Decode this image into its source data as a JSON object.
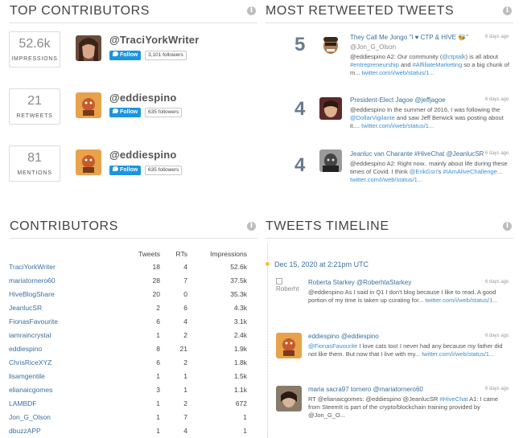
{
  "top_contributors": {
    "title": "TOP CONTRIBUTORS",
    "rows": [
      {
        "stat_value": "52.6k",
        "stat_label": "IMPRESSIONS",
        "handle": "@TraciYorkWriter",
        "follow_label": "Follow",
        "followers": "3,101 followers"
      },
      {
        "stat_value": "21",
        "stat_label": "RETWEETS",
        "handle": "@eddiespino",
        "follow_label": "Follow",
        "followers": "635 followers"
      },
      {
        "stat_value": "81",
        "stat_label": "MENTIONS",
        "handle": "@eddiespino",
        "follow_label": "Follow",
        "followers": "635 followers"
      }
    ]
  },
  "most_retweeted": {
    "title": "MOST RETWEETED TWEETS",
    "tweets": [
      {
        "count": "5",
        "name": "They Call Me Jongo \"I ♥ CTP & HIVE 🐝\"",
        "handle": "@Jon_G_Olson",
        "time": "6 days ago",
        "text_plain_1": "@eddiespino A2: Our community (",
        "text_link_1": "@ctptalk",
        "text_plain_2": ") is all about ",
        "text_link_2": "#entrepreneurship",
        "text_plain_3": " and ",
        "text_link_3": "#AffiliateMarketing",
        "text_plain_4": " so a big chunk of m... ",
        "url": "twitter.com/i/web/status/1..."
      },
      {
        "count": "4",
        "name": "President-Elect Jagoe",
        "handle": "@jeffjagoe",
        "time": "6 days ago",
        "text_plain_1": "@eddiespino In the summer of 2016, I was following the ",
        "text_link_1": "@DollarVigilante",
        "text_plain_2": " and saw Jeff Berwick was posting about it.... ",
        "url": "twitter.com/i/web/status/1..."
      },
      {
        "count": "4",
        "name": "Jeanluc van Charante #HiveChat",
        "handle": "@JeanlucSR",
        "time": "6 days ago",
        "text_plain_1": "@eddiespino A2: Right now.. mainly about life during these times of Covid. I think ",
        "text_link_1": "@ErikGsn",
        "text_plain_2": "'s ",
        "text_link_2": "#IAmAliveChallenge",
        "text_plain_3": "... ",
        "url": "twitter.com/i/web/status/1..."
      }
    ]
  },
  "contributors": {
    "title": "CONTRIBUTORS",
    "columns": [
      "Tweets",
      "RTs",
      "Impressions"
    ],
    "rows": [
      {
        "user": "TraciYorkWriter",
        "tweets": "18",
        "rts": "4",
        "impressions": "52.6k"
      },
      {
        "user": "mariatornero60",
        "tweets": "28",
        "rts": "7",
        "impressions": "37.5k"
      },
      {
        "user": "HiveBlogShare",
        "tweets": "20",
        "rts": "0",
        "impressions": "35.3k"
      },
      {
        "user": "JeanlucSR",
        "tweets": "2",
        "rts": "6",
        "impressions": "4.3k"
      },
      {
        "user": "FionasFavourite",
        "tweets": "6",
        "rts": "4",
        "impressions": "3.1k"
      },
      {
        "user": "iamraincrystal",
        "tweets": "1",
        "rts": "2",
        "impressions": "2.4k"
      },
      {
        "user": "eddiespino",
        "tweets": "8",
        "rts": "21",
        "impressions": "1.9k"
      },
      {
        "user": "ChrisRiceXYZ",
        "tweets": "6",
        "rts": "2",
        "impressions": "1.8k"
      },
      {
        "user": "lisamgentile",
        "tweets": "1",
        "rts": "1",
        "impressions": "1.5k"
      },
      {
        "user": "elianaicgomes",
        "tweets": "3",
        "rts": "1",
        "impressions": "1.1k"
      },
      {
        "user": "LAMBDF",
        "tweets": "1",
        "rts": "2",
        "impressions": "672"
      },
      {
        "user": "Jon_G_Olson",
        "tweets": "1",
        "rts": "7",
        "impressions": "1"
      },
      {
        "user": "dbuzzAPP",
        "tweets": "1",
        "rts": "4",
        "impressions": "1"
      }
    ]
  },
  "timeline": {
    "title": "TWEETS TIMELINE",
    "date": "Dec 15, 2020 at 2:21pm UTC",
    "items": [
      {
        "avatar_alt": "Roberht",
        "name": "Roberta Starkey",
        "handle": "@RoberhtaStarkey",
        "time": "6 days ago",
        "text": "@eddiespino As I said in Q1 I don't blog because I like to read. A good portion of my time is taken up curating for...",
        "url": "twitter.com/i/web/status/1..."
      },
      {
        "name": "eddiespino",
        "handle": "@eddiespino",
        "time": "6 days ago",
        "text_link_1": "@FionasFavourite",
        "text_plain_1": " I love cats too! I never had any because my father did not like them. But now that I live with my...",
        "url": "twitter.com/i/web/status/1..."
      },
      {
        "name": "maria sacra97 tornero",
        "handle": "@mariatornero60",
        "time": "6 days ago",
        "text_plain_1": "RT @elianaicgomes: @eddiespino @JeanlucSR ",
        "text_link_1": "#HiveChat",
        "text_plain_2": " A1: I came from SteemIt is part of the crypto/blockchain training provided by @Jon_G_O..."
      }
    ]
  },
  "colors": {
    "link": "#3b6fa0",
    "accent_link": "#3b8fd0",
    "follow_blue": "#1b95e0",
    "timeline_dot": "#f3c137",
    "rt_count": "#6a7a8e"
  }
}
